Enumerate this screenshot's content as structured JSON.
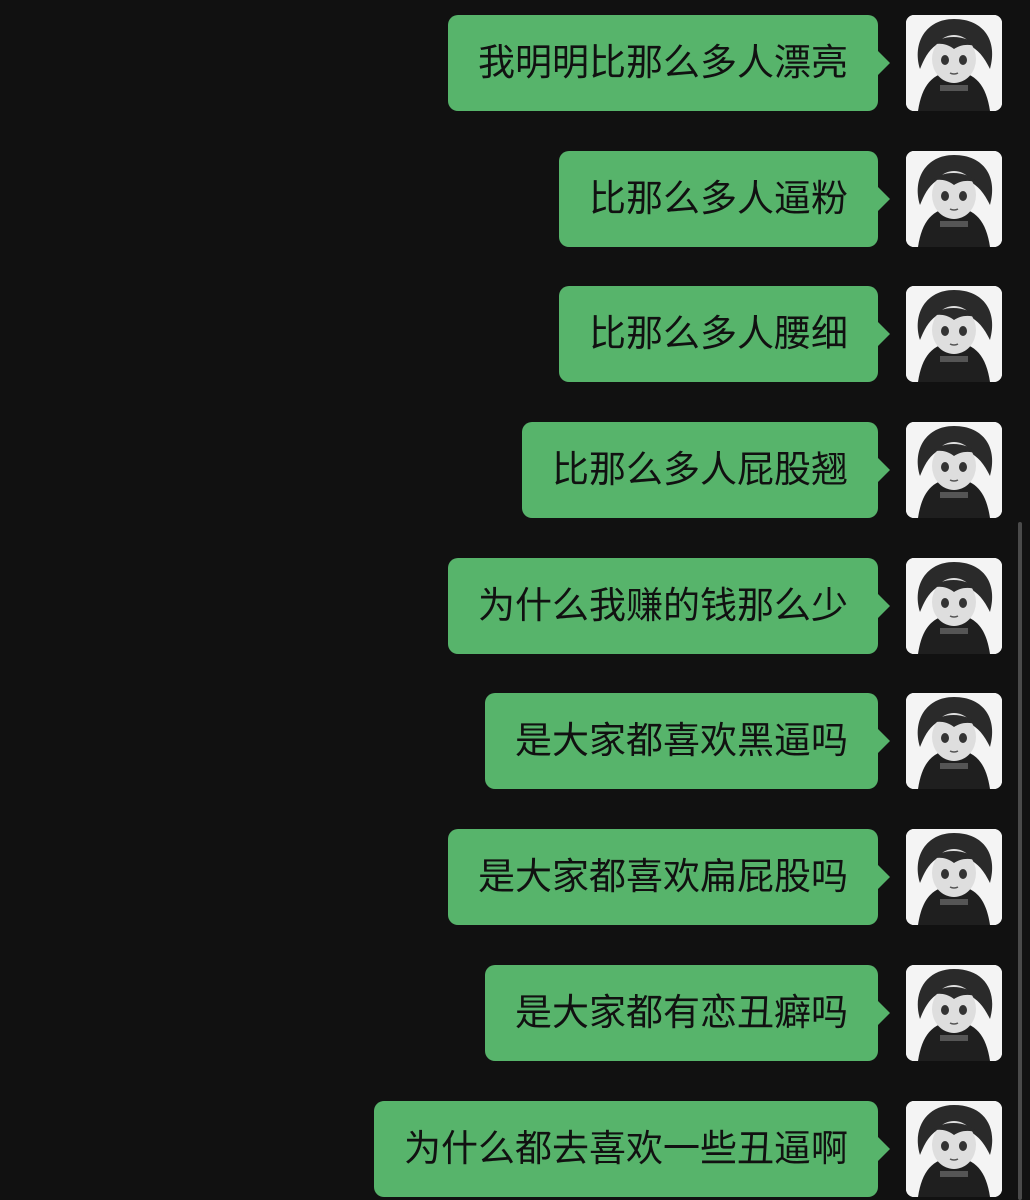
{
  "chat": {
    "messages": [
      {
        "text": "我明明比那么多人漂亮",
        "sender": "self",
        "avatar_icon": "anime-girl-avatar-icon"
      },
      {
        "text": "比那么多人逼粉",
        "sender": "self",
        "avatar_icon": "anime-girl-avatar-icon"
      },
      {
        "text": "比那么多人腰细",
        "sender": "self",
        "avatar_icon": "anime-girl-avatar-icon"
      },
      {
        "text": "比那么多人屁股翘",
        "sender": "self",
        "avatar_icon": "anime-girl-avatar-icon"
      },
      {
        "text": "为什么我赚的钱那么少",
        "sender": "self",
        "avatar_icon": "anime-girl-avatar-icon"
      },
      {
        "text": "是大家都喜欢黑逼吗",
        "sender": "self",
        "avatar_icon": "anime-girl-avatar-icon"
      },
      {
        "text": "是大家都喜欢扁屁股吗",
        "sender": "self",
        "avatar_icon": "anime-girl-avatar-icon"
      },
      {
        "text": "是大家都有恋丑癖吗",
        "sender": "self",
        "avatar_icon": "anime-girl-avatar-icon"
      },
      {
        "text": "为什么都去喜欢一些丑逼啊",
        "sender": "self",
        "avatar_icon": "anime-girl-avatar-icon"
      }
    ]
  },
  "colors": {
    "background": "#111111",
    "bubble_self": "#57b46b",
    "text": "#111111"
  }
}
